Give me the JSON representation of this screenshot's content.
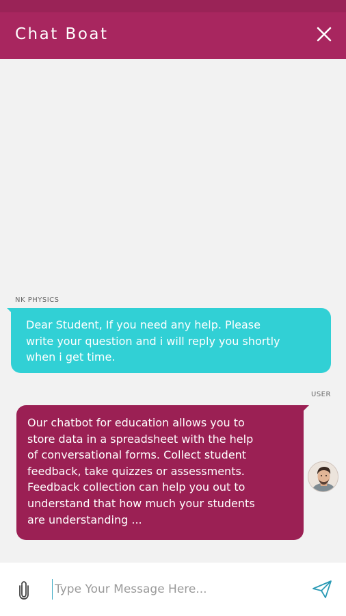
{
  "header": {
    "title": "Chat Boat",
    "close_icon": "close-icon"
  },
  "messages": [
    {
      "sender": "NK PHYSICS",
      "role": "bot",
      "lines": [
        "Dear Student, If you need any help. Please",
        "write your question and i will reply you shortly",
        "when i get time."
      ]
    },
    {
      "sender": "USER",
      "role": "user",
      "lines": [
        "Our chatbot for education allows you to",
        "store data in a spreadsheet with the help",
        "of conversational forms. Collect student",
        "feedback, take quizzes or assessments.",
        "Feedback collection can help you out to",
        "understand that how much your students",
        "are understanding ..."
      ]
    }
  ],
  "composer": {
    "placeholder": "Type Your Message Here...",
    "value": "",
    "attach_icon": "paperclip-icon",
    "send_icon": "send-icon"
  },
  "colors": {
    "header": "#a8265f",
    "status_bar": "#9a2357",
    "bot_bubble": "#31d0d5",
    "user_bubble": "#9b2054",
    "background": "#f2f2f2"
  }
}
